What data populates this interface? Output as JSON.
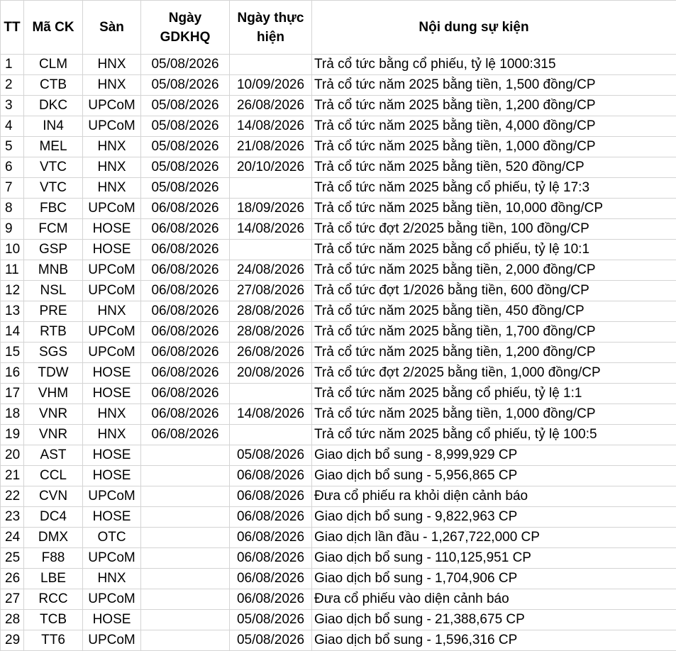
{
  "headers": {
    "tt": "TT",
    "ma": "Mã CK",
    "san": "Sàn",
    "gdkhq": "Ngày GDKHQ",
    "thuc_hien": "Ngày thực hiện",
    "noi_dung": "Nội dung sự kiện"
  },
  "rows": [
    {
      "tt": "1",
      "ma": "CLM",
      "san": "HNX",
      "gdkhq": "05/08/2026",
      "thuc_hien": "",
      "noi_dung": "Trả cổ tức bằng cổ phiếu, tỷ lệ 1000:315"
    },
    {
      "tt": "2",
      "ma": "CTB",
      "san": "HNX",
      "gdkhq": "05/08/2026",
      "thuc_hien": "10/09/2026",
      "noi_dung": "Trả cổ tức năm 2025 bằng tiền, 1,500 đồng/CP"
    },
    {
      "tt": "3",
      "ma": "DKC",
      "san": "UPCoM",
      "gdkhq": "05/08/2026",
      "thuc_hien": "26/08/2026",
      "noi_dung": "Trả cổ tức năm 2025 bằng tiền, 1,200 đồng/CP"
    },
    {
      "tt": "4",
      "ma": "IN4",
      "san": "UPCoM",
      "gdkhq": "05/08/2026",
      "thuc_hien": "14/08/2026",
      "noi_dung": "Trả cổ tức năm 2025 bằng tiền, 4,000 đồng/CP"
    },
    {
      "tt": "5",
      "ma": "MEL",
      "san": "HNX",
      "gdkhq": "05/08/2026",
      "thuc_hien": "21/08/2026",
      "noi_dung": "Trả cổ tức năm 2025 bằng tiền, 1,000 đồng/CP"
    },
    {
      "tt": "6",
      "ma": "VTC",
      "san": "HNX",
      "gdkhq": "05/08/2026",
      "thuc_hien": "20/10/2026",
      "noi_dung": "Trả cổ tức năm 2025 bằng tiền, 520 đồng/CP"
    },
    {
      "tt": "7",
      "ma": "VTC",
      "san": "HNX",
      "gdkhq": "05/08/2026",
      "thuc_hien": "",
      "noi_dung": "Trả cổ tức năm 2025 bằng cổ phiếu, tỷ lệ 17:3"
    },
    {
      "tt": "8",
      "ma": "FBC",
      "san": "UPCoM",
      "gdkhq": "06/08/2026",
      "thuc_hien": "18/09/2026",
      "noi_dung": "Trả cổ tức năm 2025 bằng tiền, 10,000 đồng/CP"
    },
    {
      "tt": "9",
      "ma": "FCM",
      "san": "HOSE",
      "gdkhq": "06/08/2026",
      "thuc_hien": "14/08/2026",
      "noi_dung": "Trả cổ tức đợt 2/2025 bằng tiền, 100 đồng/CP"
    },
    {
      "tt": "10",
      "ma": "GSP",
      "san": "HOSE",
      "gdkhq": "06/08/2026",
      "thuc_hien": "",
      "noi_dung": "Trả cổ tức năm 2025 bằng cổ phiếu, tỷ lệ 10:1"
    },
    {
      "tt": "11",
      "ma": "MNB",
      "san": "UPCoM",
      "gdkhq": "06/08/2026",
      "thuc_hien": "24/08/2026",
      "noi_dung": "Trả cổ tức năm 2025 bằng tiền, 2,000 đồng/CP"
    },
    {
      "tt": "12",
      "ma": "NSL",
      "san": "UPCoM",
      "gdkhq": "06/08/2026",
      "thuc_hien": "27/08/2026",
      "noi_dung": "Trả cổ tức đợt 1/2026 bằng tiền, 600 đồng/CP"
    },
    {
      "tt": "13",
      "ma": "PRE",
      "san": "HNX",
      "gdkhq": "06/08/2026",
      "thuc_hien": "28/08/2026",
      "noi_dung": "Trả cổ tức năm 2025 bằng tiền, 450 đồng/CP"
    },
    {
      "tt": "14",
      "ma": "RTB",
      "san": "UPCoM",
      "gdkhq": "06/08/2026",
      "thuc_hien": "28/08/2026",
      "noi_dung": "Trả cổ tức năm 2025 bằng tiền, 1,700 đồng/CP"
    },
    {
      "tt": "15",
      "ma": "SGS",
      "san": "UPCoM",
      "gdkhq": "06/08/2026",
      "thuc_hien": "26/08/2026",
      "noi_dung": "Trả cổ tức năm 2025 bằng tiền, 1,200 đồng/CP"
    },
    {
      "tt": "16",
      "ma": "TDW",
      "san": "HOSE",
      "gdkhq": "06/08/2026",
      "thuc_hien": "20/08/2026",
      "noi_dung": "Trả cổ tức đợt 2/2025 bằng tiền, 1,000 đồng/CP"
    },
    {
      "tt": "17",
      "ma": "VHM",
      "san": "HOSE",
      "gdkhq": "06/08/2026",
      "thuc_hien": "",
      "noi_dung": "Trả cổ tức năm 2025 bằng cổ phiếu, tỷ lệ 1:1"
    },
    {
      "tt": "18",
      "ma": "VNR",
      "san": "HNX",
      "gdkhq": "06/08/2026",
      "thuc_hien": "14/08/2026",
      "noi_dung": "Trả cổ tức năm 2025 bằng tiền, 1,000 đồng/CP"
    },
    {
      "tt": "19",
      "ma": "VNR",
      "san": "HNX",
      "gdkhq": "06/08/2026",
      "thuc_hien": "",
      "noi_dung": "Trả cổ tức năm 2025 bằng cổ phiếu, tỷ lệ 100:5"
    },
    {
      "tt": "20",
      "ma": "AST",
      "san": "HOSE",
      "gdkhq": "",
      "thuc_hien": "05/08/2026",
      "noi_dung": "Giao dịch bổ sung - 8,999,929 CP"
    },
    {
      "tt": "21",
      "ma": "CCL",
      "san": "HOSE",
      "gdkhq": "",
      "thuc_hien": "06/08/2026",
      "noi_dung": "Giao dịch bổ sung - 5,956,865 CP"
    },
    {
      "tt": "22",
      "ma": "CVN",
      "san": "UPCoM",
      "gdkhq": "",
      "thuc_hien": "06/08/2026",
      "noi_dung": "Đưa cổ phiếu ra khỏi diện cảnh báo"
    },
    {
      "tt": "23",
      "ma": "DC4",
      "san": "HOSE",
      "gdkhq": "",
      "thuc_hien": "06/08/2026",
      "noi_dung": "Giao dịch bổ sung - 9,822,963 CP"
    },
    {
      "tt": "24",
      "ma": "DMX",
      "san": "OTC",
      "gdkhq": "",
      "thuc_hien": "06/08/2026",
      "noi_dung": "Giao dịch lần đầu - 1,267,722,000 CP"
    },
    {
      "tt": "25",
      "ma": "F88",
      "san": "UPCoM",
      "gdkhq": "",
      "thuc_hien": "06/08/2026",
      "noi_dung": "Giao dịch bổ sung - 110,125,951 CP"
    },
    {
      "tt": "26",
      "ma": "LBE",
      "san": "HNX",
      "gdkhq": "",
      "thuc_hien": "06/08/2026",
      "noi_dung": "Giao dịch bổ sung - 1,704,906 CP"
    },
    {
      "tt": "27",
      "ma": "RCC",
      "san": "UPCoM",
      "gdkhq": "",
      "thuc_hien": "06/08/2026",
      "noi_dung": "Đưa cổ phiếu vào diện cảnh báo"
    },
    {
      "tt": "28",
      "ma": "TCB",
      "san": "HOSE",
      "gdkhq": "",
      "thuc_hien": "05/08/2026",
      "noi_dung": "Giao dịch bổ sung - 21,388,675 CP"
    },
    {
      "tt": "29",
      "ma": "TT6",
      "san": "UPCoM",
      "gdkhq": "",
      "thuc_hien": "05/08/2026",
      "noi_dung": "Giao dịch bổ sung - 1,596,316 CP"
    }
  ]
}
